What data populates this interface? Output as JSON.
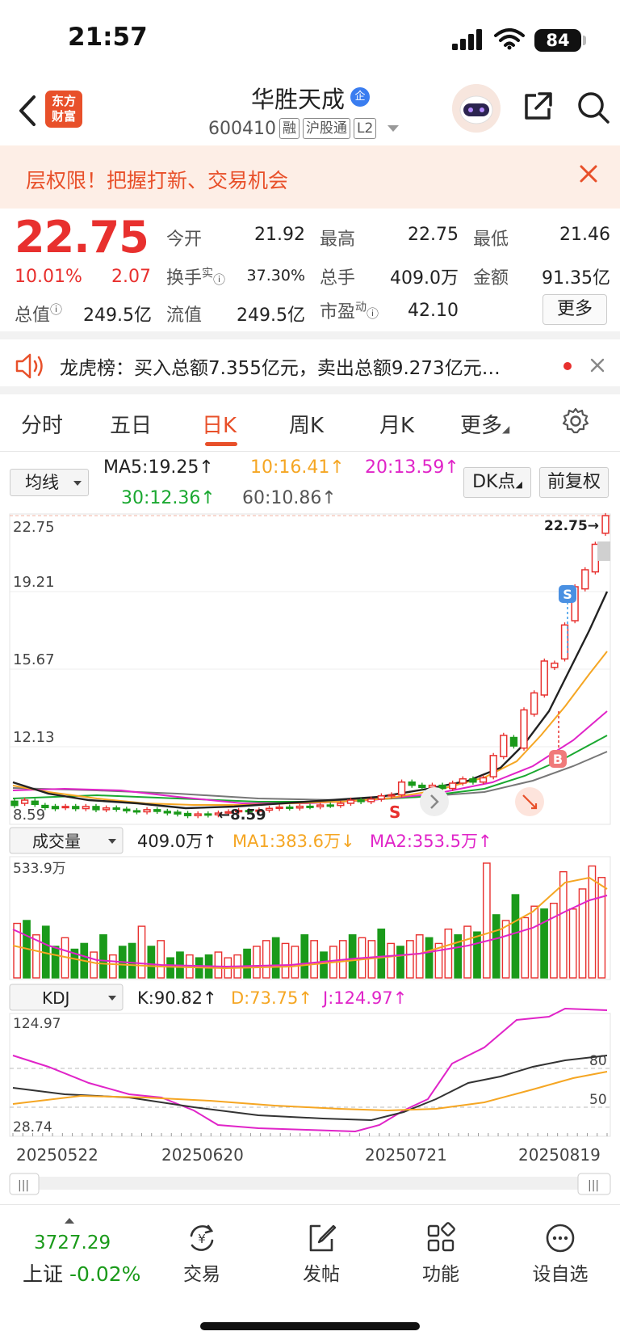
{
  "status": {
    "time": "21:57",
    "battery": "84"
  },
  "header": {
    "logo": [
      "东方",
      "财富"
    ],
    "stock_name": "华胜天成",
    "qi_badge": "企",
    "code": "600410",
    "tags": [
      "融",
      "沪股通",
      "L2"
    ]
  },
  "banner": {
    "text": "层权限！把握打新、交易机会"
  },
  "quote": {
    "price": "22.75",
    "pct": "10.01%",
    "change": "2.07",
    "open_label": "今开",
    "open": "21.92",
    "high_label": "最高",
    "high": "22.75",
    "low_label": "最低",
    "low": "21.46",
    "turnover_label": "换手",
    "turnover_sup": "实",
    "turnover": "37.30%",
    "volume_label": "总手",
    "volume": "409.0万",
    "amount_label": "金额",
    "amount": "91.35亿",
    "mktcap_label": "总值",
    "mktcap": "249.5亿",
    "float_label": "流值",
    "float": "249.5亿",
    "pe_label": "市盈",
    "pe_sup": "动",
    "pe": "42.10",
    "more_label": "更多"
  },
  "dragon_tiger": {
    "text": "龙虎榜：买入总额7.355亿元，卖出总额9.273亿元…"
  },
  "tabs": [
    "分时",
    "五日",
    "日K",
    "周K",
    "月K",
    "更多"
  ],
  "active_tab": "日K",
  "ma_row": {
    "selector": "均线",
    "ma5": "MA5:19.25↑",
    "ma10": "10:16.41↑",
    "ma20": "20:13.59↑",
    "ma30": "30:12.36↑",
    "ma60": "60:10.86↑",
    "dk_label": "DK点",
    "fq_label": "前复权"
  },
  "colors": {
    "up": "#e8302e",
    "down": "#1a9a1a",
    "ma5": "#222222",
    "ma10": "#f5a623",
    "ma20": "#e024c8",
    "ma30": "#1aa830",
    "ma60": "#777777",
    "accent": "#e8502a"
  },
  "chart_data": [
    {
      "type": "candlestick",
      "name": "日K",
      "y_ticks": [
        "22.75",
        "19.21",
        "15.67",
        "12.13",
        "8.59"
      ],
      "ylim": [
        8.59,
        22.75
      ],
      "last_label": "22.75→",
      "low_label": "←8.59",
      "markers": [
        "S",
        "B",
        "S"
      ],
      "candles": [
        {
          "o": 9.3,
          "c": 9.1
        },
        {
          "o": 9.2,
          "c": 9.35
        },
        {
          "o": 9.3,
          "c": 9.15
        },
        {
          "o": 9.1,
          "c": 9.0
        },
        {
          "o": 9.05,
          "c": 8.95
        },
        {
          "o": 9.0,
          "c": 9.05
        },
        {
          "o": 9.05,
          "c": 8.95
        },
        {
          "o": 8.95,
          "c": 9.05
        },
        {
          "o": 9.05,
          "c": 8.9
        },
        {
          "o": 8.9,
          "c": 8.98
        },
        {
          "o": 8.98,
          "c": 8.92
        },
        {
          "o": 8.92,
          "c": 8.85
        },
        {
          "o": 8.85,
          "c": 8.8
        },
        {
          "o": 8.8,
          "c": 8.9
        },
        {
          "o": 8.9,
          "c": 8.82
        },
        {
          "o": 8.82,
          "c": 8.75
        },
        {
          "o": 8.78,
          "c": 8.7
        },
        {
          "o": 8.72,
          "c": 8.62
        },
        {
          "o": 8.62,
          "c": 8.7
        },
        {
          "o": 8.7,
          "c": 8.65
        },
        {
          "o": 8.66,
          "c": 8.74
        },
        {
          "o": 8.74,
          "c": 8.8
        },
        {
          "o": 8.8,
          "c": 8.86
        },
        {
          "o": 8.86,
          "c": 8.82
        },
        {
          "o": 8.84,
          "c": 8.88
        },
        {
          "o": 8.88,
          "c": 8.96
        },
        {
          "o": 8.96,
          "c": 9.02
        },
        {
          "o": 9.02,
          "c": 8.98
        },
        {
          "o": 8.98,
          "c": 9.06
        },
        {
          "o": 9.06,
          "c": 9.04
        },
        {
          "o": 9.04,
          "c": 9.12
        },
        {
          "o": 9.12,
          "c": 9.1
        },
        {
          "o": 9.1,
          "c": 9.2
        },
        {
          "o": 9.2,
          "c": 9.35
        },
        {
          "o": 9.35,
          "c": 9.28
        },
        {
          "o": 9.28,
          "c": 9.4
        },
        {
          "o": 9.4,
          "c": 9.55
        },
        {
          "o": 9.55,
          "c": 9.6
        },
        {
          "o": 9.6,
          "c": 10.2
        },
        {
          "o": 10.2,
          "c": 10.05
        },
        {
          "o": 10.05,
          "c": 9.95
        },
        {
          "o": 9.95,
          "c": 10.05
        },
        {
          "o": 10.05,
          "c": 9.9
        },
        {
          "o": 9.9,
          "c": 10.15
        },
        {
          "o": 10.15,
          "c": 10.35
        },
        {
          "o": 10.35,
          "c": 10.2
        },
        {
          "o": 10.2,
          "c": 10.4
        },
        {
          "o": 10.45,
          "c": 11.45
        },
        {
          "o": 11.4,
          "c": 12.4
        },
        {
          "o": 12.3,
          "c": 11.9
        },
        {
          "o": 11.8,
          "c": 13.6
        },
        {
          "o": 13.4,
          "c": 14.4
        },
        {
          "o": 14.3,
          "c": 15.9
        },
        {
          "o": 15.6,
          "c": 15.8
        },
        {
          "o": 16.0,
          "c": 17.6
        },
        {
          "o": 17.8,
          "c": 19.4
        },
        {
          "o": 19.3,
          "c": 20.2
        },
        {
          "o": 20.1,
          "c": 21.4
        },
        {
          "o": 21.92,
          "c": 22.75
        }
      ]
    },
    {
      "type": "bar",
      "name": "成交量",
      "legend": {
        "selector": "成交量",
        "vol": "409.0万↑",
        "ma1": "MA1:383.6万↓",
        "ma2": "MA2:353.5万↑"
      },
      "y_top_label": "533.9万",
      "ymax": 533.9
    },
    {
      "type": "line",
      "name": "KDJ",
      "legend": {
        "selector": "KDJ",
        "k": "K:90.82↑",
        "d": "D:73.75↑",
        "j": "J:124.97↑"
      },
      "y_ticks": [
        "124.97",
        "28.74"
      ],
      "ref_labels": [
        "80",
        "50"
      ],
      "x_labels": [
        "20250522",
        "20250620",
        "20250721",
        "20250819"
      ]
    }
  ],
  "bottom_nav": {
    "index_value": "3727.29",
    "index_name": "上证",
    "index_pct": "-0.02%",
    "items": [
      "交易",
      "发帖",
      "功能",
      "设自选"
    ]
  }
}
